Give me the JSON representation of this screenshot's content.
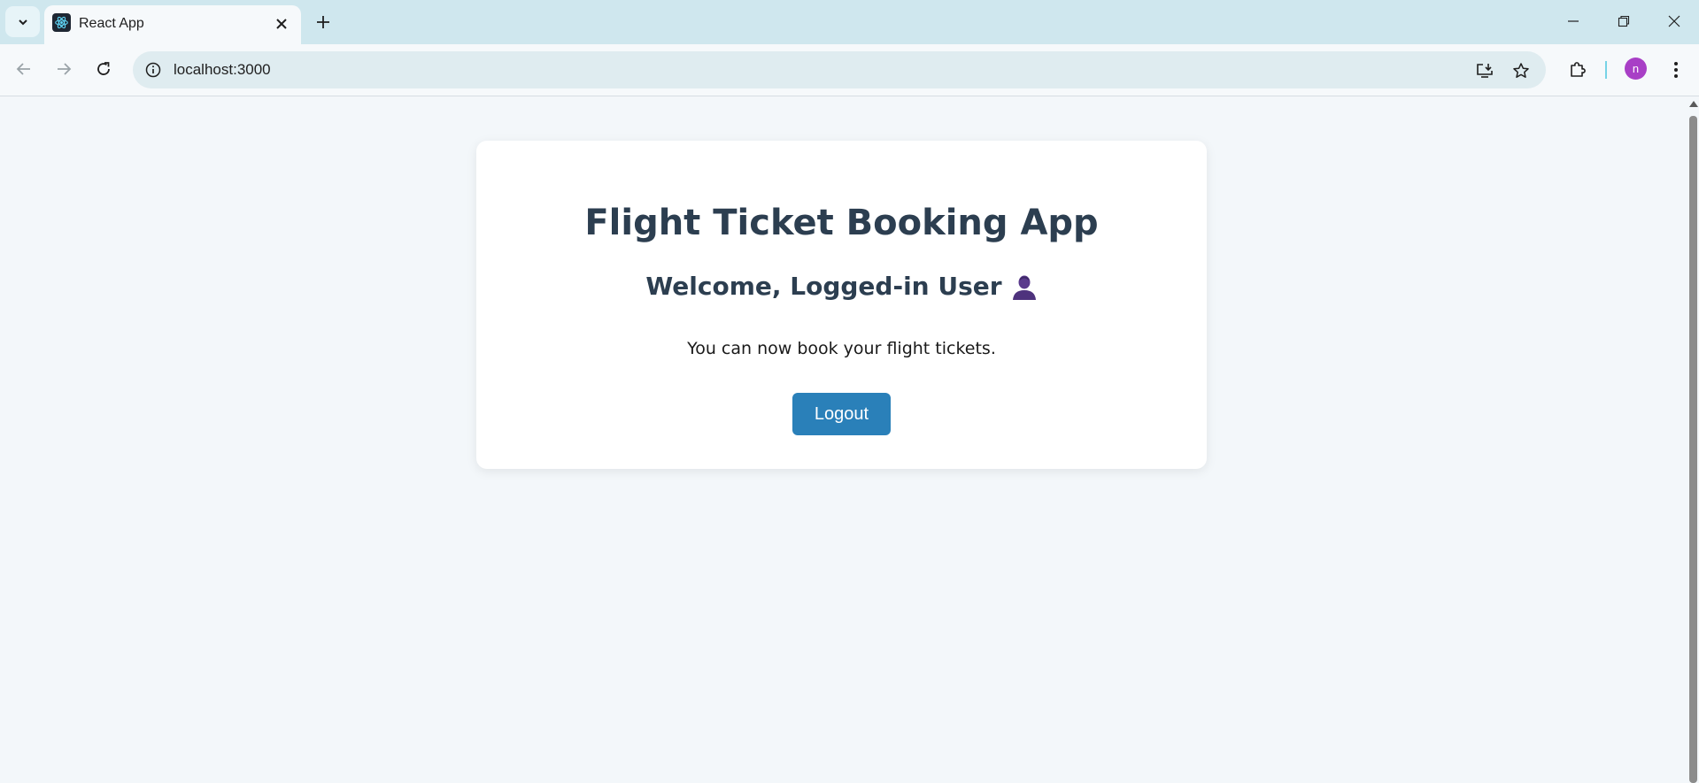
{
  "browser": {
    "tab_title": "React App",
    "url": "localhost:3000",
    "profile_initial": "n"
  },
  "icons": {
    "tab_search": "chevron-down-icon",
    "favicon": "react-logo-icon",
    "tab_close": "close-icon",
    "new_tab": "plus-icon",
    "minimize": "minimize-icon",
    "restore": "restore-icon",
    "close_window": "close-icon",
    "back": "arrow-left-icon",
    "forward": "arrow-right-icon",
    "reload": "reload-icon",
    "site_info": "info-icon",
    "install": "install-app-icon",
    "bookmark": "star-icon",
    "extensions": "puzzle-icon",
    "menu": "kebab-menu-icon",
    "welcome": "person-icon"
  },
  "page": {
    "title": "Flight Ticket Booking App",
    "welcome": "Welcome, Logged-in User",
    "message": "You can now book your flight tickets.",
    "logout_label": "Logout"
  },
  "colors": {
    "primary_button": "#2a80b9",
    "heading": "#2c3e50",
    "background": "#f3f7fa",
    "avatar": "#a83fc6"
  }
}
